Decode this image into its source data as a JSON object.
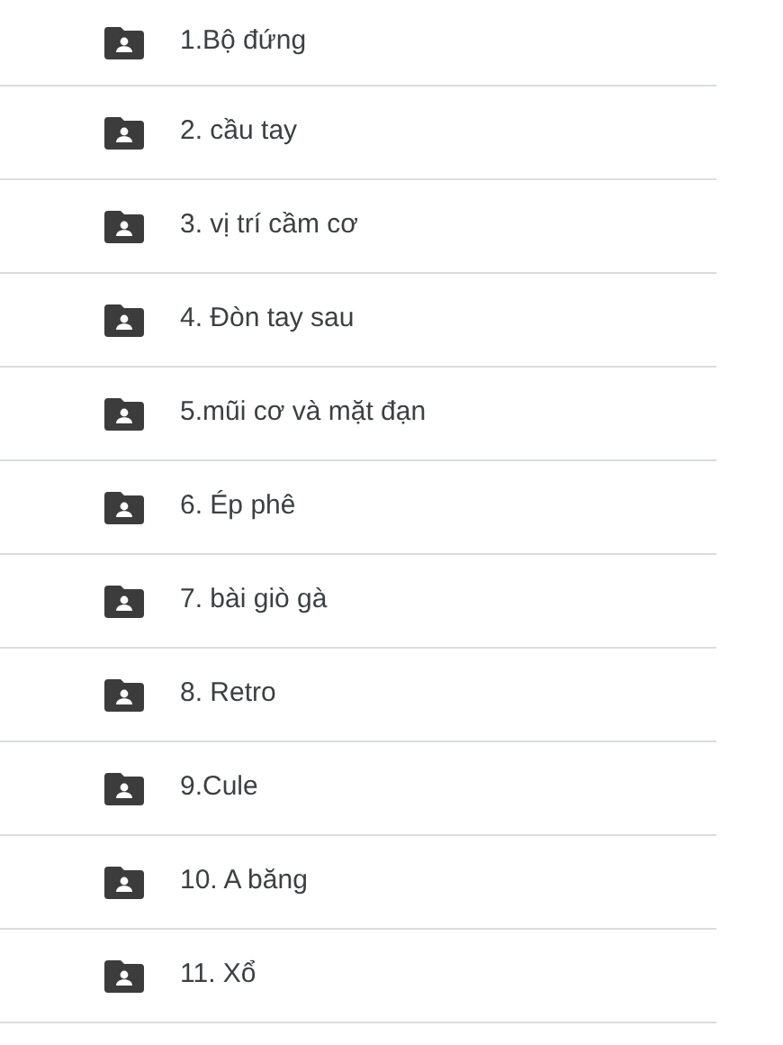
{
  "folders": [
    {
      "name": "1.Bộ đứng"
    },
    {
      "name": "2. cầu tay"
    },
    {
      "name": "3. vị trí cầm cơ"
    },
    {
      "name": "4. Đòn tay sau"
    },
    {
      "name": "5.mũi cơ và mặt đạn"
    },
    {
      "name": "6. Ép phê"
    },
    {
      "name": "7. bài giò gà"
    },
    {
      "name": "8. Retro"
    },
    {
      "name": "9.Cule"
    },
    {
      "name": "10. A băng"
    },
    {
      "name": "11. Xổ"
    }
  ]
}
